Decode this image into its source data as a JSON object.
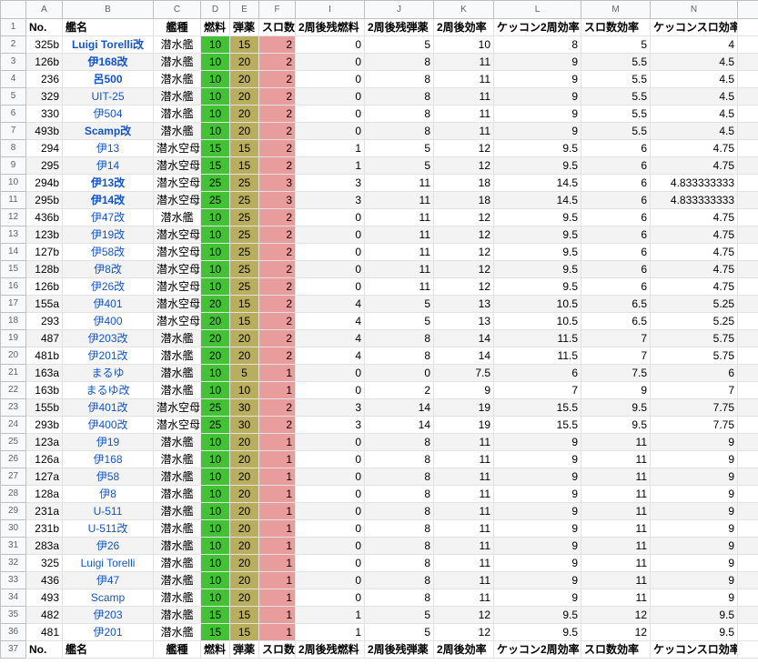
{
  "column_headers": [
    "A",
    "B",
    "C",
    "D",
    "E",
    "F",
    "I",
    "J",
    "K",
    "L",
    "M",
    "N"
  ],
  "header_row": {
    "no": "No.",
    "name": "艦名",
    "type": "艦種",
    "fuel": "燃料",
    "ammo": "弾薬",
    "slot": "スロ数",
    "fuel_after": "2周後残燃料",
    "ammo_after": "2周後残弾薬",
    "eff": "2周後効率",
    "kk_eff": "ケッコン2周効率",
    "slot_eff": "スロ数効率",
    "kk_slot_eff": "ケッコンスロ効率"
  },
  "colors": {
    "fuel": "#44c236",
    "ammo": "#b9ae5e",
    "slot": "#e89c9c",
    "link": "#1155cc"
  },
  "rows": [
    {
      "no": "325b",
      "name": "Luigi Torelli改",
      "bold": true,
      "type": "潜水艦",
      "fuel": "10",
      "ammo": "15",
      "slot": "2",
      "i": "0",
      "j": "5",
      "k": "10",
      "l": "8",
      "m": "5",
      "n": "4"
    },
    {
      "no": "126b",
      "name": "伊168改",
      "bold": true,
      "type": "潜水艦",
      "fuel": "10",
      "ammo": "20",
      "slot": "2",
      "i": "0",
      "j": "8",
      "k": "11",
      "l": "9",
      "m": "5.5",
      "n": "4.5"
    },
    {
      "no": "236",
      "name": "呂500",
      "bold": true,
      "type": "潜水艦",
      "fuel": "10",
      "ammo": "20",
      "slot": "2",
      "i": "0",
      "j": "8",
      "k": "11",
      "l": "9",
      "m": "5.5",
      "n": "4.5"
    },
    {
      "no": "329",
      "name": "UIT-25",
      "bold": false,
      "type": "潜水艦",
      "fuel": "10",
      "ammo": "20",
      "slot": "2",
      "i": "0",
      "j": "8",
      "k": "11",
      "l": "9",
      "m": "5.5",
      "n": "4.5"
    },
    {
      "no": "330",
      "name": "伊504",
      "bold": false,
      "type": "潜水艦",
      "fuel": "10",
      "ammo": "20",
      "slot": "2",
      "i": "0",
      "j": "8",
      "k": "11",
      "l": "9",
      "m": "5.5",
      "n": "4.5"
    },
    {
      "no": "493b",
      "name": "Scamp改",
      "bold": true,
      "type": "潜水艦",
      "fuel": "10",
      "ammo": "20",
      "slot": "2",
      "i": "0",
      "j": "8",
      "k": "11",
      "l": "9",
      "m": "5.5",
      "n": "4.5"
    },
    {
      "no": "294",
      "name": "伊13",
      "bold": false,
      "type": "潜水空母",
      "fuel": "15",
      "ammo": "15",
      "slot": "2",
      "i": "1",
      "j": "5",
      "k": "12",
      "l": "9.5",
      "m": "6",
      "n": "4.75"
    },
    {
      "no": "295",
      "name": "伊14",
      "bold": false,
      "type": "潜水空母",
      "fuel": "15",
      "ammo": "15",
      "slot": "2",
      "i": "1",
      "j": "5",
      "k": "12",
      "l": "9.5",
      "m": "6",
      "n": "4.75"
    },
    {
      "no": "294b",
      "name": "伊13改",
      "bold": true,
      "type": "潜水空母",
      "fuel": "25",
      "ammo": "25",
      "slot": "3",
      "i": "3",
      "j": "11",
      "k": "18",
      "l": "14.5",
      "m": "6",
      "n": "4.833333333"
    },
    {
      "no": "295b",
      "name": "伊14改",
      "bold": true,
      "type": "潜水空母",
      "fuel": "25",
      "ammo": "25",
      "slot": "3",
      "i": "3",
      "j": "11",
      "k": "18",
      "l": "14.5",
      "m": "6",
      "n": "4.833333333"
    },
    {
      "no": "436b",
      "name": "伊47改",
      "bold": false,
      "type": "潜水艦",
      "fuel": "10",
      "ammo": "25",
      "slot": "2",
      "i": "0",
      "j": "11",
      "k": "12",
      "l": "9.5",
      "m": "6",
      "n": "4.75"
    },
    {
      "no": "123b",
      "name": "伊19改",
      "bold": false,
      "type": "潜水空母",
      "fuel": "10",
      "ammo": "25",
      "slot": "2",
      "i": "0",
      "j": "11",
      "k": "12",
      "l": "9.5",
      "m": "6",
      "n": "4.75"
    },
    {
      "no": "127b",
      "name": "伊58改",
      "bold": false,
      "type": "潜水空母",
      "fuel": "10",
      "ammo": "25",
      "slot": "2",
      "i": "0",
      "j": "11",
      "k": "12",
      "l": "9.5",
      "m": "6",
      "n": "4.75"
    },
    {
      "no": "128b",
      "name": "伊8改",
      "bold": false,
      "type": "潜水空母",
      "fuel": "10",
      "ammo": "25",
      "slot": "2",
      "i": "0",
      "j": "11",
      "k": "12",
      "l": "9.5",
      "m": "6",
      "n": "4.75"
    },
    {
      "no": "126b",
      "name": "伊26改",
      "bold": false,
      "type": "潜水空母",
      "fuel": "10",
      "ammo": "25",
      "slot": "2",
      "i": "0",
      "j": "11",
      "k": "12",
      "l": "9.5",
      "m": "6",
      "n": "4.75"
    },
    {
      "no": "155a",
      "name": "伊401",
      "bold": false,
      "type": "潜水空母",
      "fuel": "20",
      "ammo": "15",
      "slot": "2",
      "i": "4",
      "j": "5",
      "k": "13",
      "l": "10.5",
      "m": "6.5",
      "n": "5.25"
    },
    {
      "no": "293",
      "name": "伊400",
      "bold": false,
      "type": "潜水空母",
      "fuel": "20",
      "ammo": "15",
      "slot": "2",
      "i": "4",
      "j": "5",
      "k": "13",
      "l": "10.5",
      "m": "6.5",
      "n": "5.25"
    },
    {
      "no": "487",
      "name": "伊203改",
      "bold": false,
      "type": "潜水艦",
      "fuel": "20",
      "ammo": "20",
      "slot": "2",
      "i": "4",
      "j": "8",
      "k": "14",
      "l": "11.5",
      "m": "7",
      "n": "5.75"
    },
    {
      "no": "481b",
      "name": "伊201改",
      "bold": false,
      "type": "潜水艦",
      "fuel": "20",
      "ammo": "20",
      "slot": "2",
      "i": "4",
      "j": "8",
      "k": "14",
      "l": "11.5",
      "m": "7",
      "n": "5.75"
    },
    {
      "no": "163a",
      "name": "まるゆ",
      "bold": false,
      "type": "潜水艦",
      "fuel": "10",
      "ammo": "5",
      "slot": "1",
      "i": "0",
      "j": "0",
      "k": "7.5",
      "l": "6",
      "m": "7.5",
      "n": "6"
    },
    {
      "no": "163b",
      "name": "まるゆ改",
      "bold": false,
      "type": "潜水艦",
      "fuel": "10",
      "ammo": "10",
      "slot": "1",
      "i": "0",
      "j": "2",
      "k": "9",
      "l": "7",
      "m": "9",
      "n": "7"
    },
    {
      "no": "155b",
      "name": "伊401改",
      "bold": false,
      "type": "潜水空母",
      "fuel": "25",
      "ammo": "30",
      "slot": "2",
      "i": "3",
      "j": "14",
      "k": "19",
      "l": "15.5",
      "m": "9.5",
      "n": "7.75"
    },
    {
      "no": "293b",
      "name": "伊400改",
      "bold": false,
      "type": "潜水空母",
      "fuel": "25",
      "ammo": "30",
      "slot": "2",
      "i": "3",
      "j": "14",
      "k": "19",
      "l": "15.5",
      "m": "9.5",
      "n": "7.75"
    },
    {
      "no": "123a",
      "name": "伊19",
      "bold": false,
      "type": "潜水艦",
      "fuel": "10",
      "ammo": "20",
      "slot": "1",
      "i": "0",
      "j": "8",
      "k": "11",
      "l": "9",
      "m": "11",
      "n": "9"
    },
    {
      "no": "126a",
      "name": "伊168",
      "bold": false,
      "type": "潜水艦",
      "fuel": "10",
      "ammo": "20",
      "slot": "1",
      "i": "0",
      "j": "8",
      "k": "11",
      "l": "9",
      "m": "11",
      "n": "9"
    },
    {
      "no": "127a",
      "name": "伊58",
      "bold": false,
      "type": "潜水艦",
      "fuel": "10",
      "ammo": "20",
      "slot": "1",
      "i": "0",
      "j": "8",
      "k": "11",
      "l": "9",
      "m": "11",
      "n": "9"
    },
    {
      "no": "128a",
      "name": "伊8",
      "bold": false,
      "type": "潜水艦",
      "fuel": "10",
      "ammo": "20",
      "slot": "1",
      "i": "0",
      "j": "8",
      "k": "11",
      "l": "9",
      "m": "11",
      "n": "9"
    },
    {
      "no": "231a",
      "name": "U-511",
      "bold": false,
      "type": "潜水艦",
      "fuel": "10",
      "ammo": "20",
      "slot": "1",
      "i": "0",
      "j": "8",
      "k": "11",
      "l": "9",
      "m": "11",
      "n": "9"
    },
    {
      "no": "231b",
      "name": "U-511改",
      "bold": false,
      "type": "潜水艦",
      "fuel": "10",
      "ammo": "20",
      "slot": "1",
      "i": "0",
      "j": "8",
      "k": "11",
      "l": "9",
      "m": "11",
      "n": "9"
    },
    {
      "no": "283a",
      "name": "伊26",
      "bold": false,
      "type": "潜水艦",
      "fuel": "10",
      "ammo": "20",
      "slot": "1",
      "i": "0",
      "j": "8",
      "k": "11",
      "l": "9",
      "m": "11",
      "n": "9"
    },
    {
      "no": "325",
      "name": "Luigi Torelli",
      "bold": false,
      "type": "潜水艦",
      "fuel": "10",
      "ammo": "20",
      "slot": "1",
      "i": "0",
      "j": "8",
      "k": "11",
      "l": "9",
      "m": "11",
      "n": "9"
    },
    {
      "no": "436",
      "name": "伊47",
      "bold": false,
      "type": "潜水艦",
      "fuel": "10",
      "ammo": "20",
      "slot": "1",
      "i": "0",
      "j": "8",
      "k": "11",
      "l": "9",
      "m": "11",
      "n": "9"
    },
    {
      "no": "493",
      "name": "Scamp",
      "bold": false,
      "type": "潜水艦",
      "fuel": "10",
      "ammo": "20",
      "slot": "1",
      "i": "0",
      "j": "8",
      "k": "11",
      "l": "9",
      "m": "11",
      "n": "9"
    },
    {
      "no": "482",
      "name": "伊203",
      "bold": false,
      "type": "潜水艦",
      "fuel": "15",
      "ammo": "15",
      "slot": "1",
      "i": "1",
      "j": "5",
      "k": "12",
      "l": "9.5",
      "m": "12",
      "n": "9.5"
    },
    {
      "no": "481",
      "name": "伊201",
      "bold": false,
      "type": "潜水艦",
      "fuel": "15",
      "ammo": "15",
      "slot": "1",
      "i": "1",
      "j": "5",
      "k": "12",
      "l": "9.5",
      "m": "12",
      "n": "9.5"
    }
  ]
}
